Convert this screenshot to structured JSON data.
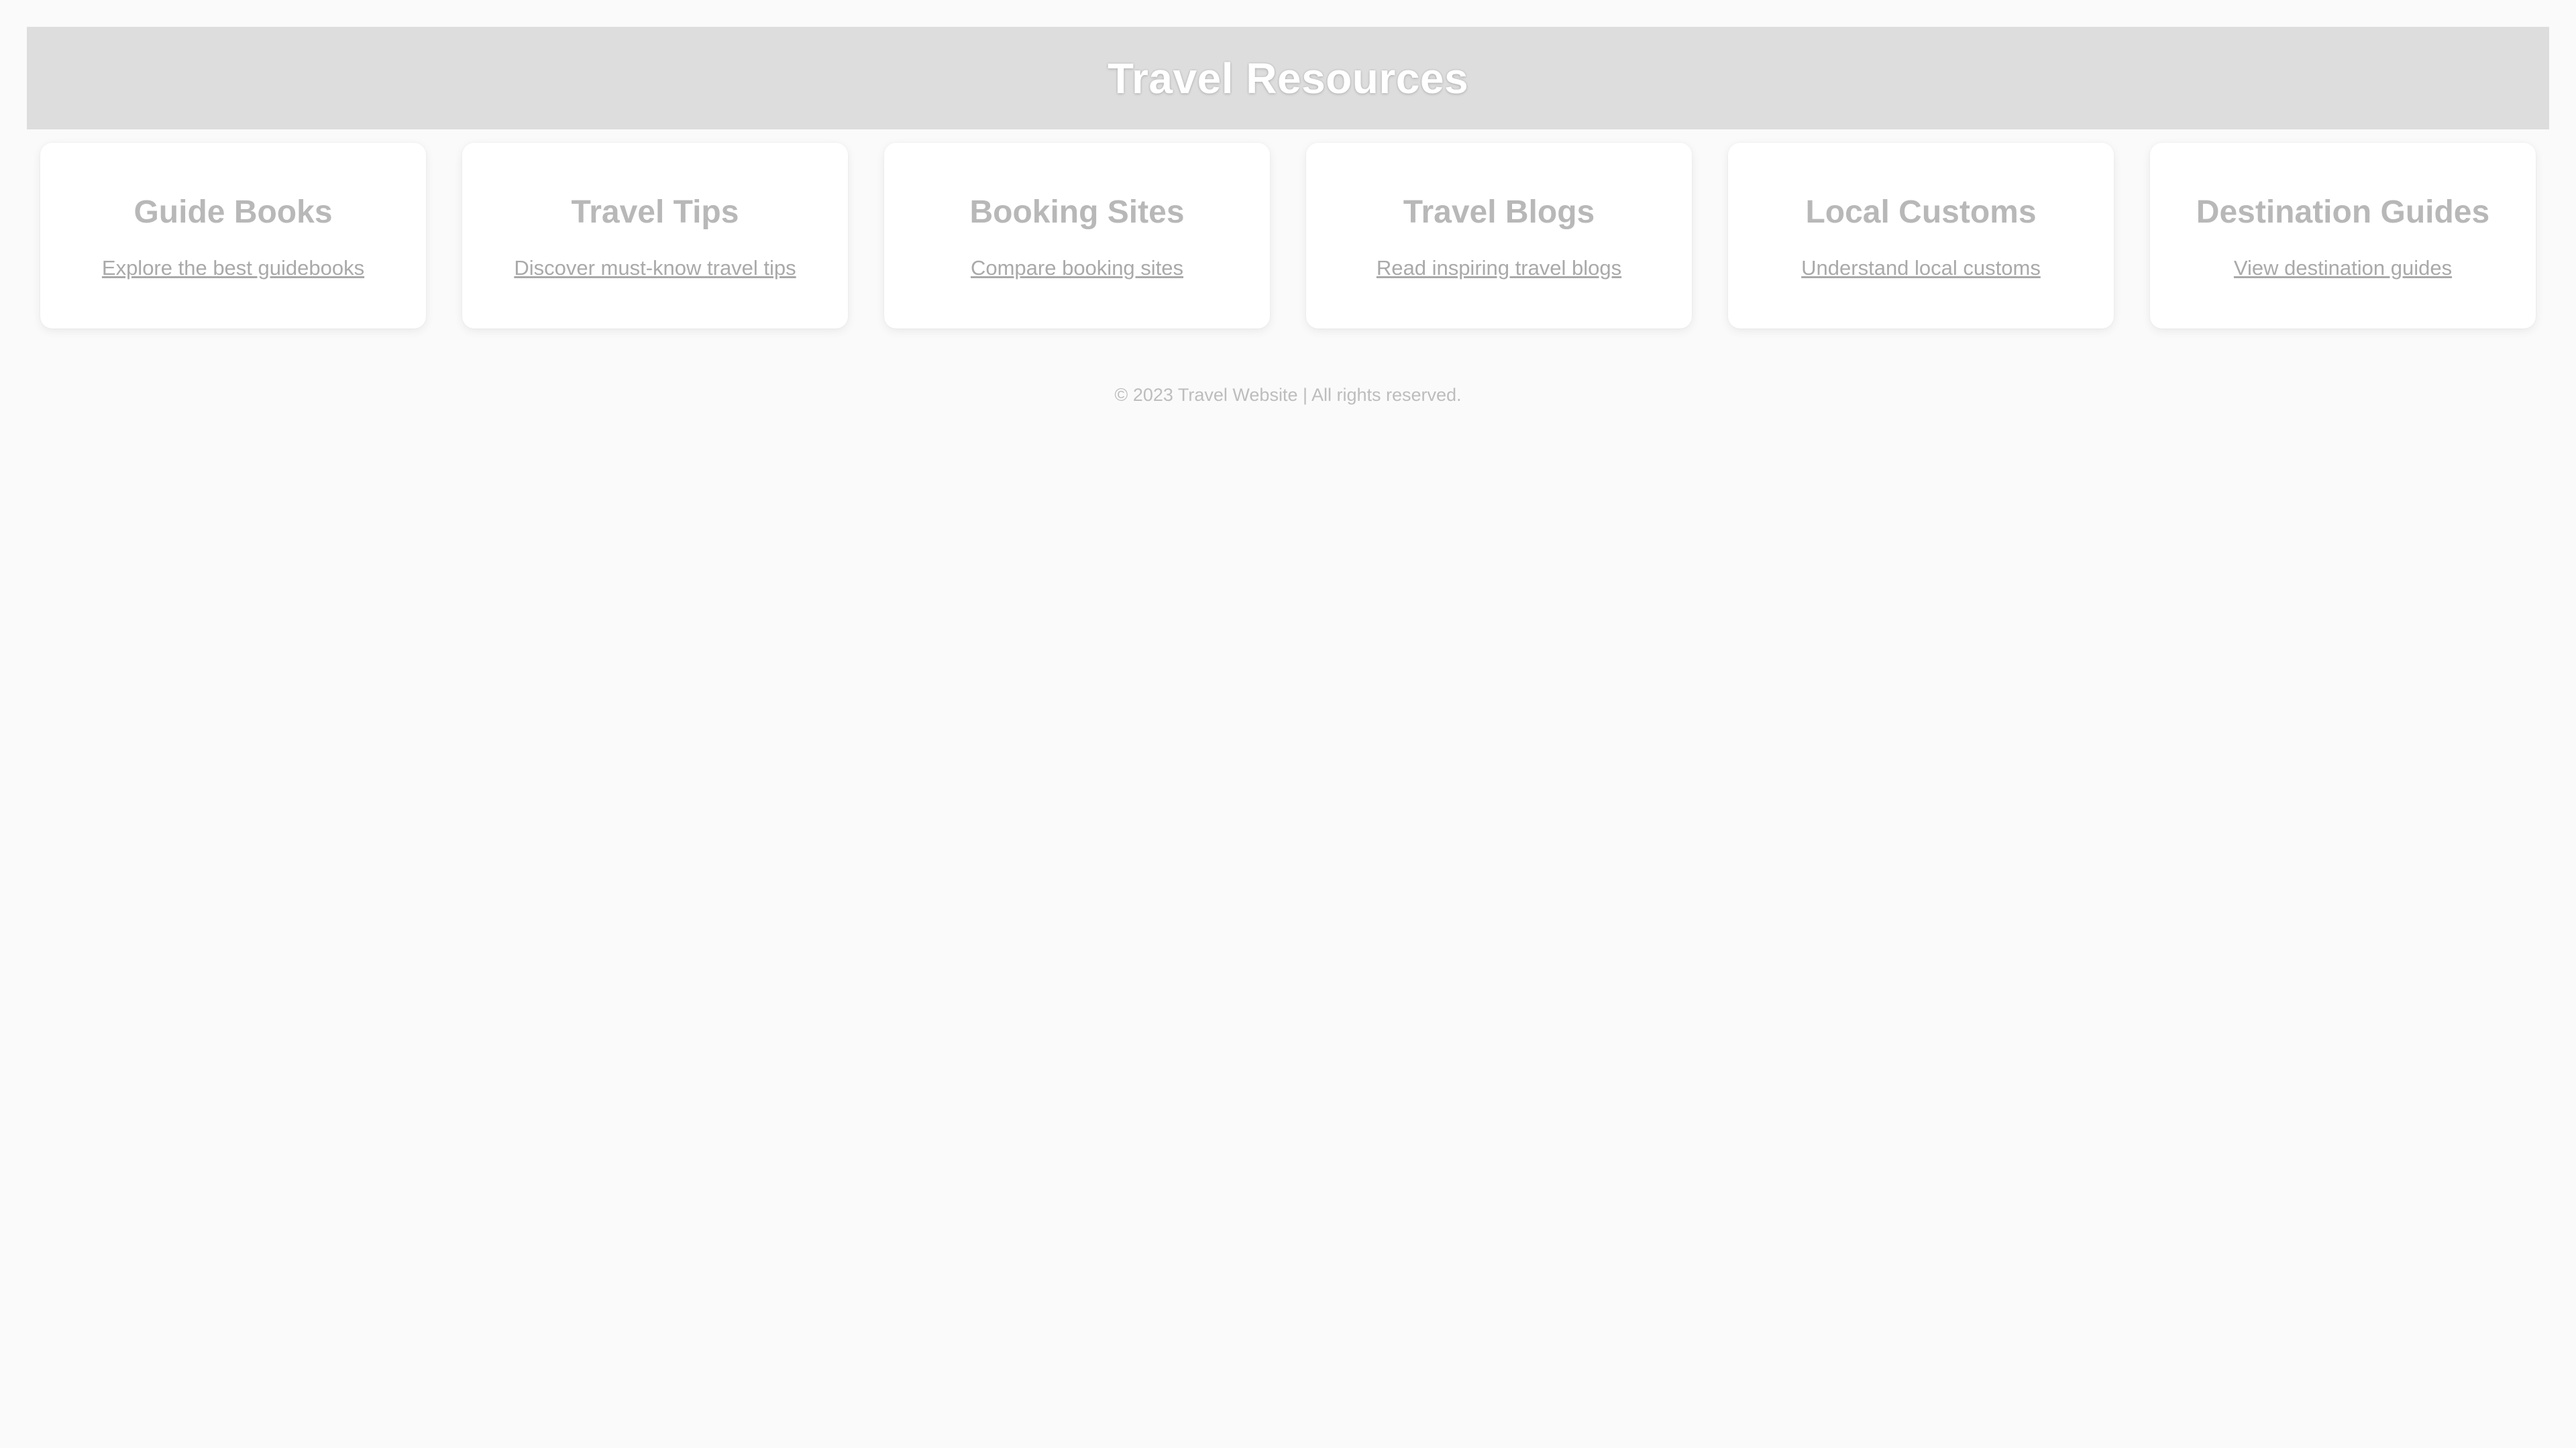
{
  "header": {
    "title": "Travel Resources"
  },
  "cards": [
    {
      "title": "Guide Books",
      "link": "Explore the best guidebooks"
    },
    {
      "title": "Travel Tips",
      "link": "Discover must-know travel tips"
    },
    {
      "title": "Booking Sites",
      "link": "Compare booking sites"
    },
    {
      "title": "Travel Blogs",
      "link": "Read inspiring travel blogs"
    },
    {
      "title": "Local Customs",
      "link": "Understand local customs"
    },
    {
      "title": "Destination Guides",
      "link": "View destination guides"
    }
  ],
  "footer": {
    "text": "© 2023 Travel Website | All rights reserved."
  },
  "colors": {
    "page_background": "#fafafa",
    "header_background": "#dddddd",
    "header_text": "#ffffff",
    "card_background": "#ffffff",
    "card_title": "#b8b8b8",
    "card_link": "#a9a9a9",
    "footer_text": "#bdbdbd"
  }
}
